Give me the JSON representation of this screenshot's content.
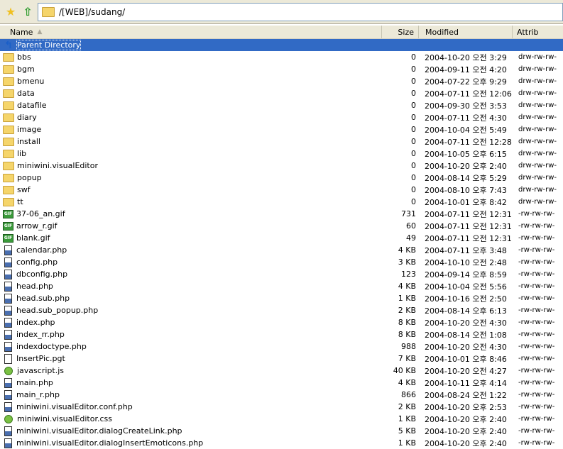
{
  "toolbar": {
    "path": "/[WEB]/sudang/",
    "icons": [
      "favorites-star-icon",
      "up-folder-icon",
      "folder-icon"
    ]
  },
  "columns": {
    "name": "Name",
    "size": "Size",
    "modified": "Modified",
    "attrib": "Attrib"
  },
  "parent": {
    "label": "Parent Directory"
  },
  "files": [
    {
      "name": "bbs",
      "size": "0",
      "modified": "2004-10-20 오전 3:29",
      "attrib": "drw-rw-rw-",
      "type": "folder"
    },
    {
      "name": "bgm",
      "size": "0",
      "modified": "2004-09-11 오전 4:20",
      "attrib": "drw-rw-rw-",
      "type": "folder"
    },
    {
      "name": "bmenu",
      "size": "0",
      "modified": "2004-07-22 오후 9:29",
      "attrib": "drw-rw-rw-",
      "type": "folder"
    },
    {
      "name": "data",
      "size": "0",
      "modified": "2004-07-11 오전 12:06",
      "attrib": "drw-rw-rw-",
      "type": "folder"
    },
    {
      "name": "datafile",
      "size": "0",
      "modified": "2004-09-30 오전 3:53",
      "attrib": "drw-rw-rw-",
      "type": "folder"
    },
    {
      "name": "diary",
      "size": "0",
      "modified": "2004-07-11 오전 4:30",
      "attrib": "drw-rw-rw-",
      "type": "folder"
    },
    {
      "name": "image",
      "size": "0",
      "modified": "2004-10-04 오전 5:49",
      "attrib": "drw-rw-rw-",
      "type": "folder"
    },
    {
      "name": "install",
      "size": "0",
      "modified": "2004-07-11 오전 12:28",
      "attrib": "drw-rw-rw-",
      "type": "folder"
    },
    {
      "name": "lib",
      "size": "0",
      "modified": "2004-10-05 오후 6:15",
      "attrib": "drw-rw-rw-",
      "type": "folder"
    },
    {
      "name": "miniwini.visualEditor",
      "size": "0",
      "modified": "2004-10-20 오후 2:40",
      "attrib": "drw-rw-rw-",
      "type": "folder"
    },
    {
      "name": "popup",
      "size": "0",
      "modified": "2004-08-14 오후 5:29",
      "attrib": "drw-rw-rw-",
      "type": "folder"
    },
    {
      "name": "swf",
      "size": "0",
      "modified": "2004-08-10 오후 7:43",
      "attrib": "drw-rw-rw-",
      "type": "folder"
    },
    {
      "name": "tt",
      "size": "0",
      "modified": "2004-10-01 오후 8:42",
      "attrib": "drw-rw-rw-",
      "type": "folder"
    },
    {
      "name": "37-06_an.gif",
      "size": "731",
      "modified": "2004-07-11 오전 12:31",
      "attrib": "-rw-rw-rw-",
      "type": "gif"
    },
    {
      "name": "arrow_r.gif",
      "size": "60",
      "modified": "2004-07-11 오전 12:31",
      "attrib": "-rw-rw-rw-",
      "type": "gif"
    },
    {
      "name": "blank.gif",
      "size": "49",
      "modified": "2004-07-11 오전 12:31",
      "attrib": "-rw-rw-rw-",
      "type": "gif"
    },
    {
      "name": "calendar.php",
      "size": "4 KB",
      "modified": "2004-07-11 오후 3:48",
      "attrib": "-rw-rw-rw-",
      "type": "php"
    },
    {
      "name": "config.php",
      "size": "3 KB",
      "modified": "2004-10-10 오전 2:48",
      "attrib": "-rw-rw-rw-",
      "type": "php"
    },
    {
      "name": "dbconfig.php",
      "size": "123",
      "modified": "2004-09-14 오후 8:59",
      "attrib": "-rw-rw-rw-",
      "type": "php"
    },
    {
      "name": "head.php",
      "size": "4 KB",
      "modified": "2004-10-04 오전 5:56",
      "attrib": "-rw-rw-rw-",
      "type": "php"
    },
    {
      "name": "head.sub.php",
      "size": "1 KB",
      "modified": "2004-10-16 오전 2:50",
      "attrib": "-rw-rw-rw-",
      "type": "php"
    },
    {
      "name": "head.sub_popup.php",
      "size": "2 KB",
      "modified": "2004-08-14 오후 6:13",
      "attrib": "-rw-rw-rw-",
      "type": "php"
    },
    {
      "name": "index.php",
      "size": "8 KB",
      "modified": "2004-10-20 오전 4:30",
      "attrib": "-rw-rw-rw-",
      "type": "php"
    },
    {
      "name": "index_rr.php",
      "size": "8 KB",
      "modified": "2004-08-14 오전 1:08",
      "attrib": "-rw-rw-rw-",
      "type": "php"
    },
    {
      "name": "indexdoctype.php",
      "size": "988",
      "modified": "2004-10-20 오전 4:30",
      "attrib": "-rw-rw-rw-",
      "type": "php"
    },
    {
      "name": "InsertPic.pgt",
      "size": "7 KB",
      "modified": "2004-10-01 오후 8:46",
      "attrib": "-rw-rw-rw-",
      "type": "file"
    },
    {
      "name": "javascript.js",
      "size": "40 KB",
      "modified": "2004-10-20 오전 4:27",
      "attrib": "-rw-rw-rw-",
      "type": "js"
    },
    {
      "name": "main.php",
      "size": "4 KB",
      "modified": "2004-10-11 오후 4:14",
      "attrib": "-rw-rw-rw-",
      "type": "php"
    },
    {
      "name": "main_r.php",
      "size": "866",
      "modified": "2004-08-24 오전 1:22",
      "attrib": "-rw-rw-rw-",
      "type": "php"
    },
    {
      "name": "miniwini.visualEditor.conf.php",
      "size": "2 KB",
      "modified": "2004-10-20 오후 2:53",
      "attrib": "-rw-rw-rw-",
      "type": "php"
    },
    {
      "name": "miniwini.visualEditor.css",
      "size": "1 KB",
      "modified": "2004-10-20 오후 2:40",
      "attrib": "-rw-rw-rw-",
      "type": "css"
    },
    {
      "name": "miniwini.visualEditor.dialogCreateLink.php",
      "size": "5 KB",
      "modified": "2004-10-20 오후 2:40",
      "attrib": "-rw-rw-rw-",
      "type": "php"
    },
    {
      "name": "miniwini.visualEditor.dialogInsertEmoticons.php",
      "size": "1 KB",
      "modified": "2004-10-20 오후 2:40",
      "attrib": "-rw-rw-rw-",
      "type": "php"
    }
  ]
}
